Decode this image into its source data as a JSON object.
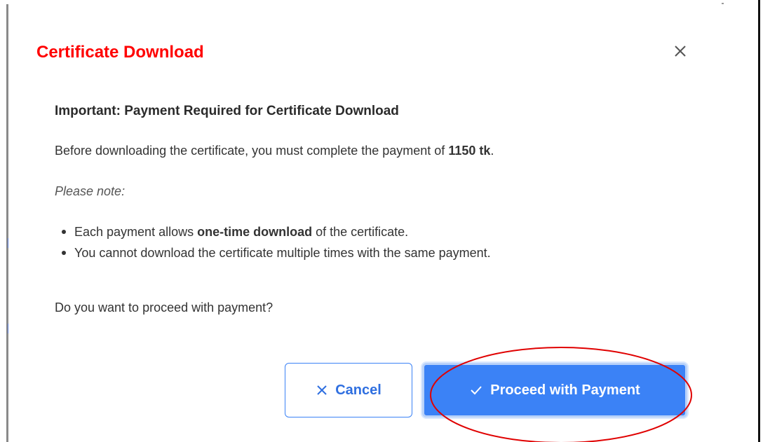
{
  "dialog": {
    "title": "Certificate Download",
    "subheading": "Important: Payment Required for Certificate Download",
    "intro_prefix": "Before downloading the certificate, you must complete the payment of ",
    "amount": "1150 tk",
    "intro_suffix": ".",
    "note_label": "Please note:",
    "bullets": [
      {
        "prefix": "Each payment allows ",
        "emphasis": "one-time download",
        "suffix": " of the certificate."
      },
      {
        "text": "You cannot download the certificate multiple times with the same payment."
      }
    ],
    "question": "Do you want to proceed with payment?"
  },
  "buttons": {
    "cancel_label": "Cancel",
    "cancel_icon": "x-icon",
    "proceed_label": "Proceed with Payment",
    "proceed_icon": "check-icon",
    "close_icon": "close-icon"
  },
  "colors": {
    "title": "#ff0000",
    "primary": "#3b82f6",
    "annotation": "#e00000",
    "text": "#333333"
  }
}
